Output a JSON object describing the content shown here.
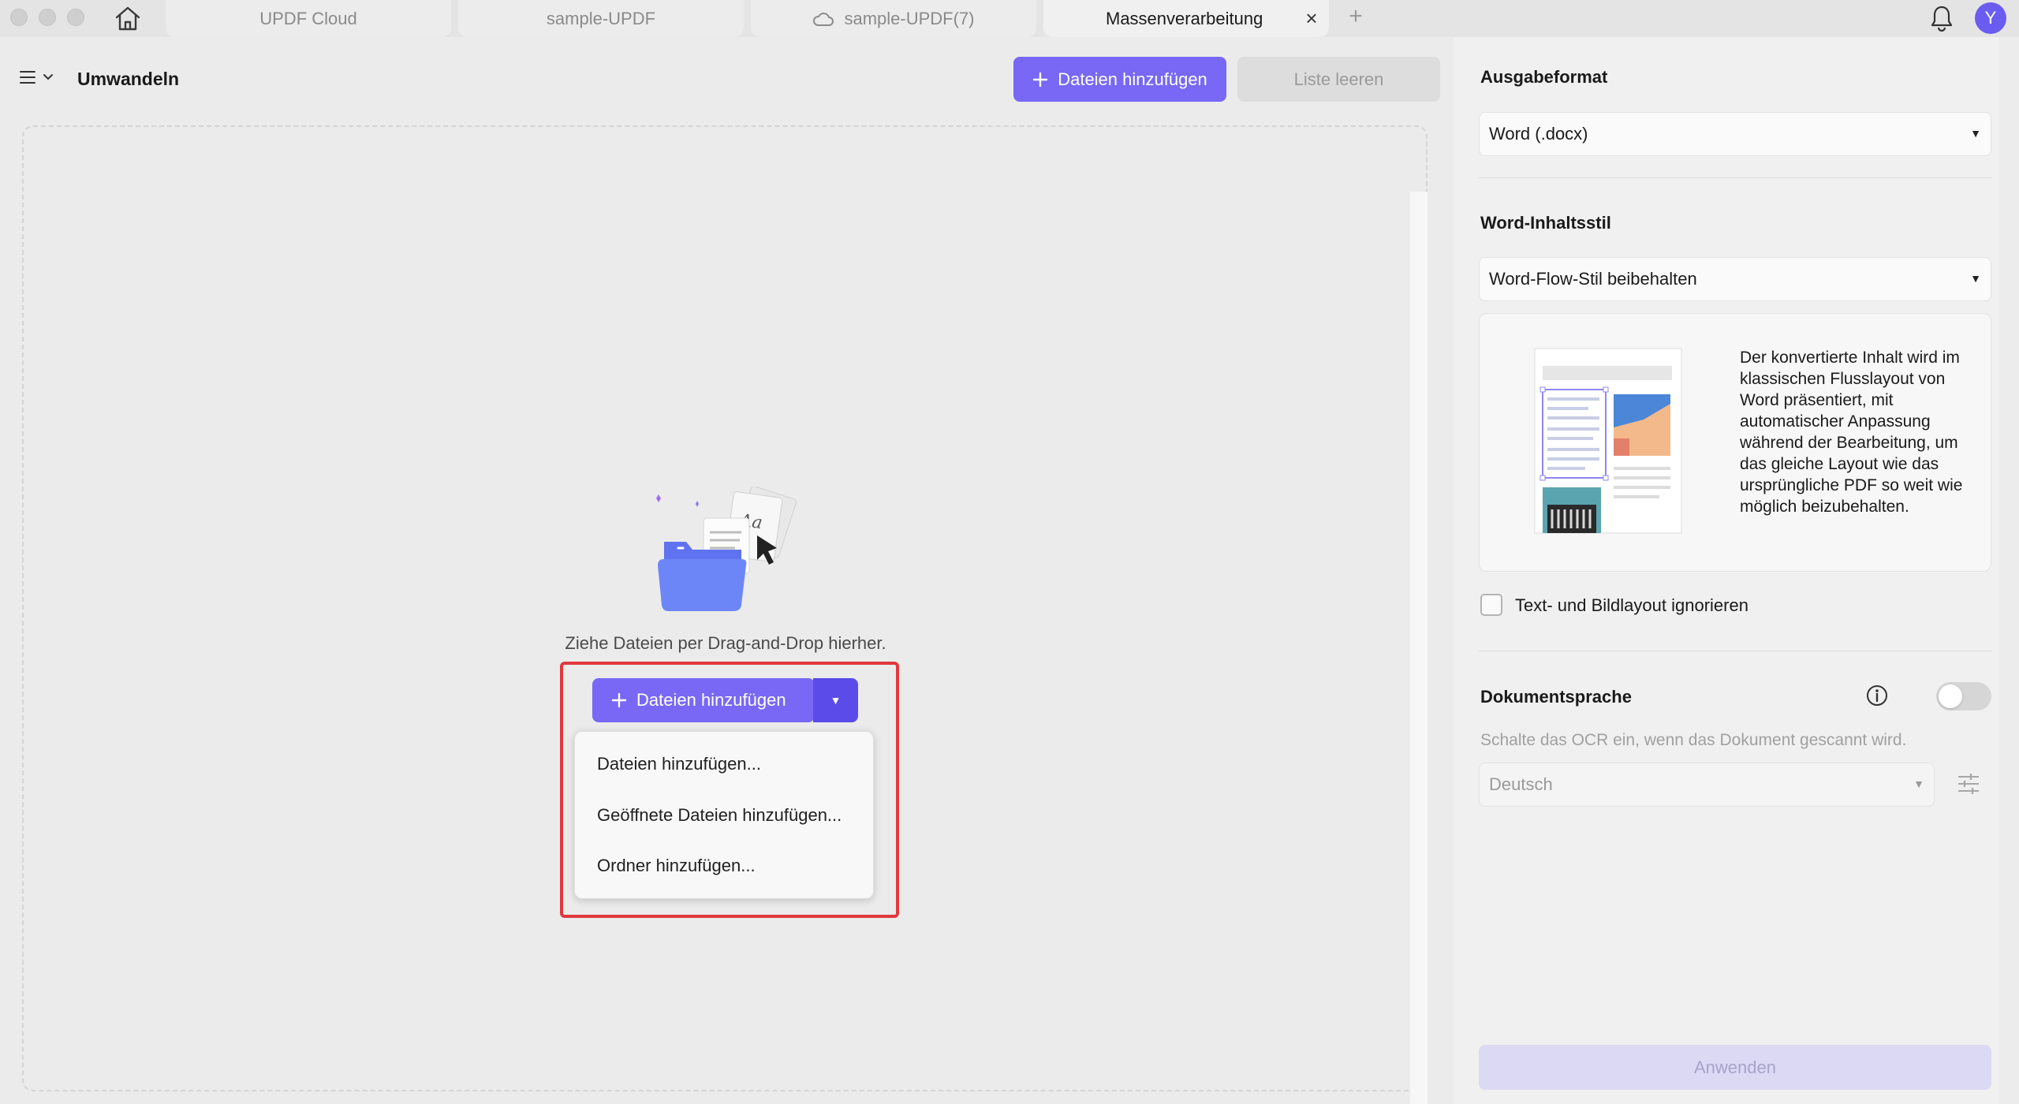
{
  "tabbar": {
    "tabs": [
      {
        "label": "UPDF Cloud"
      },
      {
        "label": "sample-UPDF"
      },
      {
        "label": "sample-UPDF(7)"
      },
      {
        "label": "Massenverarbeitung"
      }
    ],
    "close_glyph": "×",
    "plus_glyph": "+",
    "avatar_initial": "Y"
  },
  "left": {
    "title": "Umwandeln",
    "add_files_label": "Dateien hinzufügen",
    "clear_list_label": "Liste leeren",
    "drop_hint": "Ziehe Dateien per Drag-and-Drop hierher.",
    "split_button_label": "Dateien hinzufügen",
    "dropdown": [
      {
        "label": "Dateien hinzufügen..."
      },
      {
        "label": "Geöffnete Dateien hinzufügen..."
      },
      {
        "label": "Ordner hinzufügen..."
      }
    ]
  },
  "right": {
    "output_format_label": "Ausgabeformat",
    "output_format_value": "Word (.docx)",
    "content_style_label": "Word-Inhaltsstil",
    "content_style_value": "Word-Flow-Stil beibehalten",
    "preview_description": "Der konvertierte Inhalt wird im klassischen Flusslayout von Word präsentiert, mit automatischer Anpassung während der Bearbeitung, um das gleiche Layout wie das ursprüngliche PDF so weit wie möglich beizubehalten.",
    "ignore_layout_label": "Text- und Bildlayout ignorieren",
    "ignore_layout_checked": false,
    "doc_language_label": "Dokumentsprache",
    "ocr_enabled": false,
    "ocr_hint": "Schalte das OCR ein, wenn das Dokument gescannt wird.",
    "language_value": "Deutsch",
    "apply_label": "Anwenden"
  },
  "colors": {
    "accent": "#7868f5",
    "accent_dark": "#5b4be8",
    "highlight": "#e0393e"
  }
}
